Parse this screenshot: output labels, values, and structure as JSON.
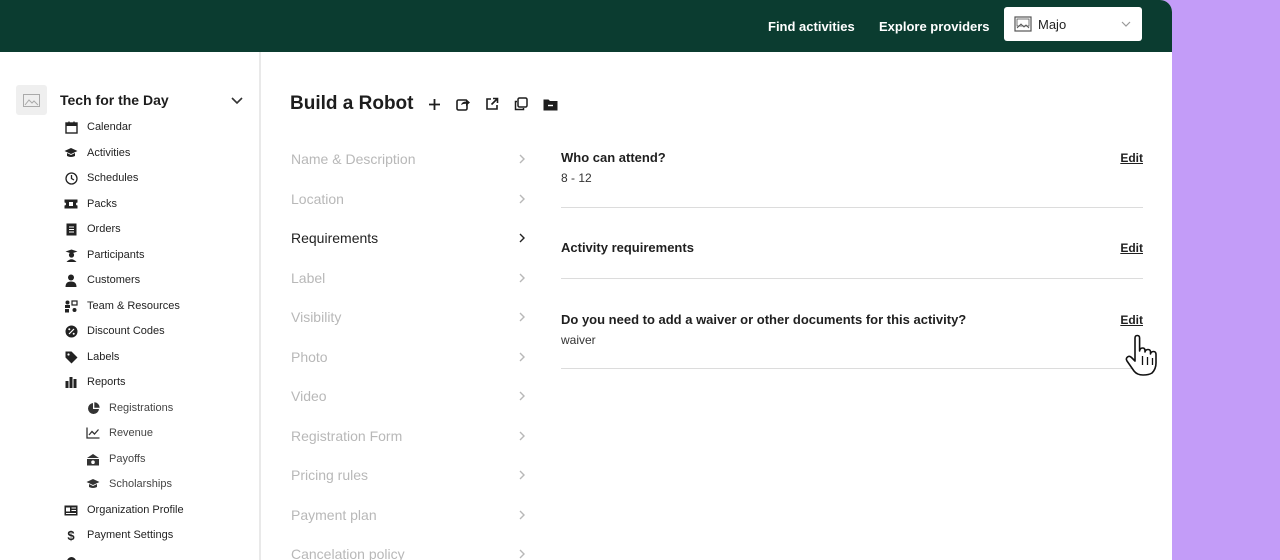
{
  "header": {
    "find_activities": "Find activities",
    "explore_providers": "Explore providers",
    "org_selector": {
      "value": "Majo"
    }
  },
  "sidebar": {
    "org_name": "Tech for the Day",
    "items": [
      {
        "label": "Calendar",
        "icon": "calendar-icon"
      },
      {
        "label": "Activities",
        "icon": "graduation-cap-icon"
      },
      {
        "label": "Schedules",
        "icon": "clock-icon"
      },
      {
        "label": "Packs",
        "icon": "ticket-icon"
      },
      {
        "label": "Orders",
        "icon": "receipt-icon"
      },
      {
        "label": "Participants",
        "icon": "student-icon"
      },
      {
        "label": "Customers",
        "icon": "user-icon"
      },
      {
        "label": "Team & Resources",
        "icon": "team-icon"
      },
      {
        "label": "Discount Codes",
        "icon": "discount-icon"
      },
      {
        "label": "Labels",
        "icon": "tag-icon"
      },
      {
        "label": "Reports",
        "icon": "bar-chart-icon"
      }
    ],
    "report_items": [
      {
        "label": "Registrations",
        "icon": "pie-chart-icon"
      },
      {
        "label": "Revenue",
        "icon": "line-chart-icon"
      },
      {
        "label": "Payoffs",
        "icon": "payoffs-icon"
      },
      {
        "label": "Scholarships",
        "icon": "graduation-cap-icon"
      }
    ],
    "bottom_items": [
      {
        "label": "Organization Profile",
        "icon": "id-card-icon"
      },
      {
        "label": "Payment Settings",
        "icon": "dollar-icon"
      }
    ]
  },
  "page": {
    "title": "Build a Robot",
    "toolbar_icons": [
      "plus-icon",
      "share-icon",
      "external-link-icon",
      "copy-icon",
      "folder-icon"
    ]
  },
  "steps": [
    {
      "label": "Name & Description",
      "active": false
    },
    {
      "label": "Location",
      "active": false
    },
    {
      "label": "Requirements",
      "active": true
    },
    {
      "label": "Label",
      "active": false
    },
    {
      "label": "Visibility",
      "active": false
    },
    {
      "label": "Photo",
      "active": false
    },
    {
      "label": "Video",
      "active": false
    },
    {
      "label": "Registration Form",
      "active": false
    },
    {
      "label": "Pricing rules",
      "active": false
    },
    {
      "label": "Payment plan",
      "active": false
    },
    {
      "label": "Cancelation policy",
      "active": false
    }
  ],
  "sections": [
    {
      "title": "Who can attend?",
      "value": "8 - 12",
      "edit": "Edit"
    },
    {
      "title": "Activity requirements",
      "value": "",
      "edit": "Edit"
    },
    {
      "title": "Do you need to add a waiver or other documents for this activity?",
      "value": "waiver",
      "edit": "Edit"
    }
  ],
  "colors": {
    "topbar": "#0b3c30",
    "backdrop": "#c39cf8",
    "inactive_step": "#b8b8b8"
  }
}
